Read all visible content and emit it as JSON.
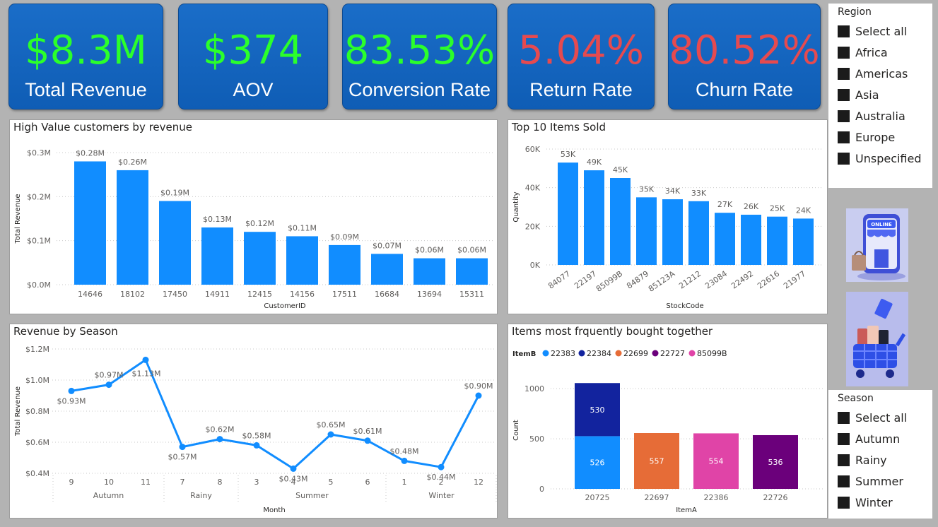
{
  "kpis": [
    {
      "value": "$8.3M",
      "label": "Total Revenue",
      "color": "#2bff2b"
    },
    {
      "value": "$374",
      "label": "AOV",
      "color": "#2bff2b"
    },
    {
      "value": "83.53%",
      "label": "Conversion Rate",
      "color": "#2bff2b"
    },
    {
      "value": "5.04%",
      "label": "Return Rate",
      "color": "#e64a4f"
    },
    {
      "value": "80.52%",
      "label": "Churn Rate",
      "color": "#e64a4f"
    }
  ],
  "region_slicer": {
    "title": "Region",
    "items": [
      "Select all",
      "Africa",
      "Americas",
      "Asia",
      "Australia",
      "Europe",
      "Unspecified"
    ]
  },
  "season_slicer": {
    "title": "Season",
    "items": [
      "Select all",
      "Autumn",
      "Rainy",
      "Summer",
      "Winter"
    ]
  },
  "images": {
    "top": {
      "icon": "online-shop-phone-icon",
      "label": "ONLINE"
    },
    "bottom": {
      "icon": "shopping-cart-bags-icon"
    }
  },
  "chart_data": [
    {
      "type": "bar",
      "title": "High Value customers by revenue",
      "xlabel": "CustomerID",
      "ylabel": "Total Revenue",
      "categories": [
        "14646",
        "18102",
        "17450",
        "14911",
        "12415",
        "14156",
        "17511",
        "16684",
        "13694",
        "15311"
      ],
      "values": [
        0.28,
        0.26,
        0.19,
        0.13,
        0.12,
        0.11,
        0.09,
        0.07,
        0.06,
        0.06
      ],
      "value_labels": [
        "$0.28M",
        "$0.26M",
        "$0.19M",
        "$0.13M",
        "$0.12M",
        "$0.11M",
        "$0.09M",
        "$0.07M",
        "$0.06M",
        "$0.06M"
      ],
      "ylim": [
        0,
        0.3
      ],
      "yticks": [
        0,
        0.1,
        0.2,
        0.3
      ],
      "ytick_labels": [
        "$0.0M",
        "$0.1M",
        "$0.2M",
        "$0.3M"
      ],
      "color": "#118dff",
      "grid": true
    },
    {
      "type": "bar",
      "title": "Top 10 Items Sold",
      "xlabel": "StockCode",
      "ylabel": "Quantity",
      "categories": [
        "84077",
        "22197",
        "85099B",
        "84879",
        "85123A",
        "21212",
        "23084",
        "22492",
        "22616",
        "21977"
      ],
      "values": [
        53,
        49,
        45,
        35,
        34,
        33,
        27,
        26,
        25,
        24
      ],
      "value_labels": [
        "53K",
        "49K",
        "45K",
        "35K",
        "34K",
        "33K",
        "27K",
        "26K",
        "25K",
        "24K"
      ],
      "ylim": [
        0,
        60
      ],
      "yticks": [
        0,
        20,
        40,
        60
      ],
      "ytick_labels": [
        "0K",
        "20K",
        "40K",
        "60K"
      ],
      "color": "#118dff",
      "grid": true
    },
    {
      "type": "line",
      "title": "Revenue by Season",
      "xlabel": "Month",
      "ylabel": "Total Revenue",
      "categories": [
        "9",
        "10",
        "11",
        "7",
        "8",
        "3",
        "4",
        "5",
        "6",
        "1",
        "2",
        "12"
      ],
      "groups": [
        {
          "name": "Autumn",
          "count": 3
        },
        {
          "name": "Rainy",
          "count": 2
        },
        {
          "name": "Summer",
          "count": 4
        },
        {
          "name": "Winter",
          "count": 3
        }
      ],
      "values": [
        0.93,
        0.97,
        1.13,
        0.57,
        0.62,
        0.58,
        0.43,
        0.65,
        0.61,
        0.48,
        0.44,
        0.9
      ],
      "value_labels": [
        "$0.93M",
        "$0.97M",
        "$1.13M",
        "$0.57M",
        "$0.62M",
        "$0.58M",
        "$0.43M",
        "$0.65M",
        "$0.61M",
        "$0.48M",
        "$0.44M",
        "$0.90M"
      ],
      "ylim": [
        0.4,
        1.2
      ],
      "yticks": [
        0.4,
        0.6,
        0.8,
        1.0,
        1.2
      ],
      "ytick_labels": [
        "$0.4M",
        "$0.6M",
        "$0.8M",
        "$1.0M",
        "$1.2M"
      ],
      "color": "#118dff",
      "grid": true
    },
    {
      "type": "bar",
      "stacked": true,
      "title": "Items most frquently bought together",
      "xlabel": "ItemA",
      "ylabel": "Count",
      "legend_title": "ItemB",
      "legend_position": "top-left",
      "categories": [
        "20725",
        "22697",
        "22386",
        "22726"
      ],
      "series": [
        {
          "name": "22383",
          "color": "#118dff",
          "values": [
            526,
            0,
            0,
            0
          ]
        },
        {
          "name": "22384",
          "color": "#12239e",
          "values": [
            530,
            0,
            0,
            0
          ]
        },
        {
          "name": "22699",
          "color": "#e66c37",
          "values": [
            0,
            557,
            0,
            0
          ]
        },
        {
          "name": "22727",
          "color": "#6b007b",
          "values": [
            0,
            0,
            0,
            536
          ]
        },
        {
          "name": "85099B",
          "color": "#e044a7",
          "values": [
            0,
            0,
            554,
            0
          ]
        }
      ],
      "ylim": [
        0,
        1100
      ],
      "yticks": [
        0,
        500,
        1000
      ],
      "ytick_labels": [
        "0",
        "500",
        "1000"
      ],
      "grid": true
    }
  ]
}
